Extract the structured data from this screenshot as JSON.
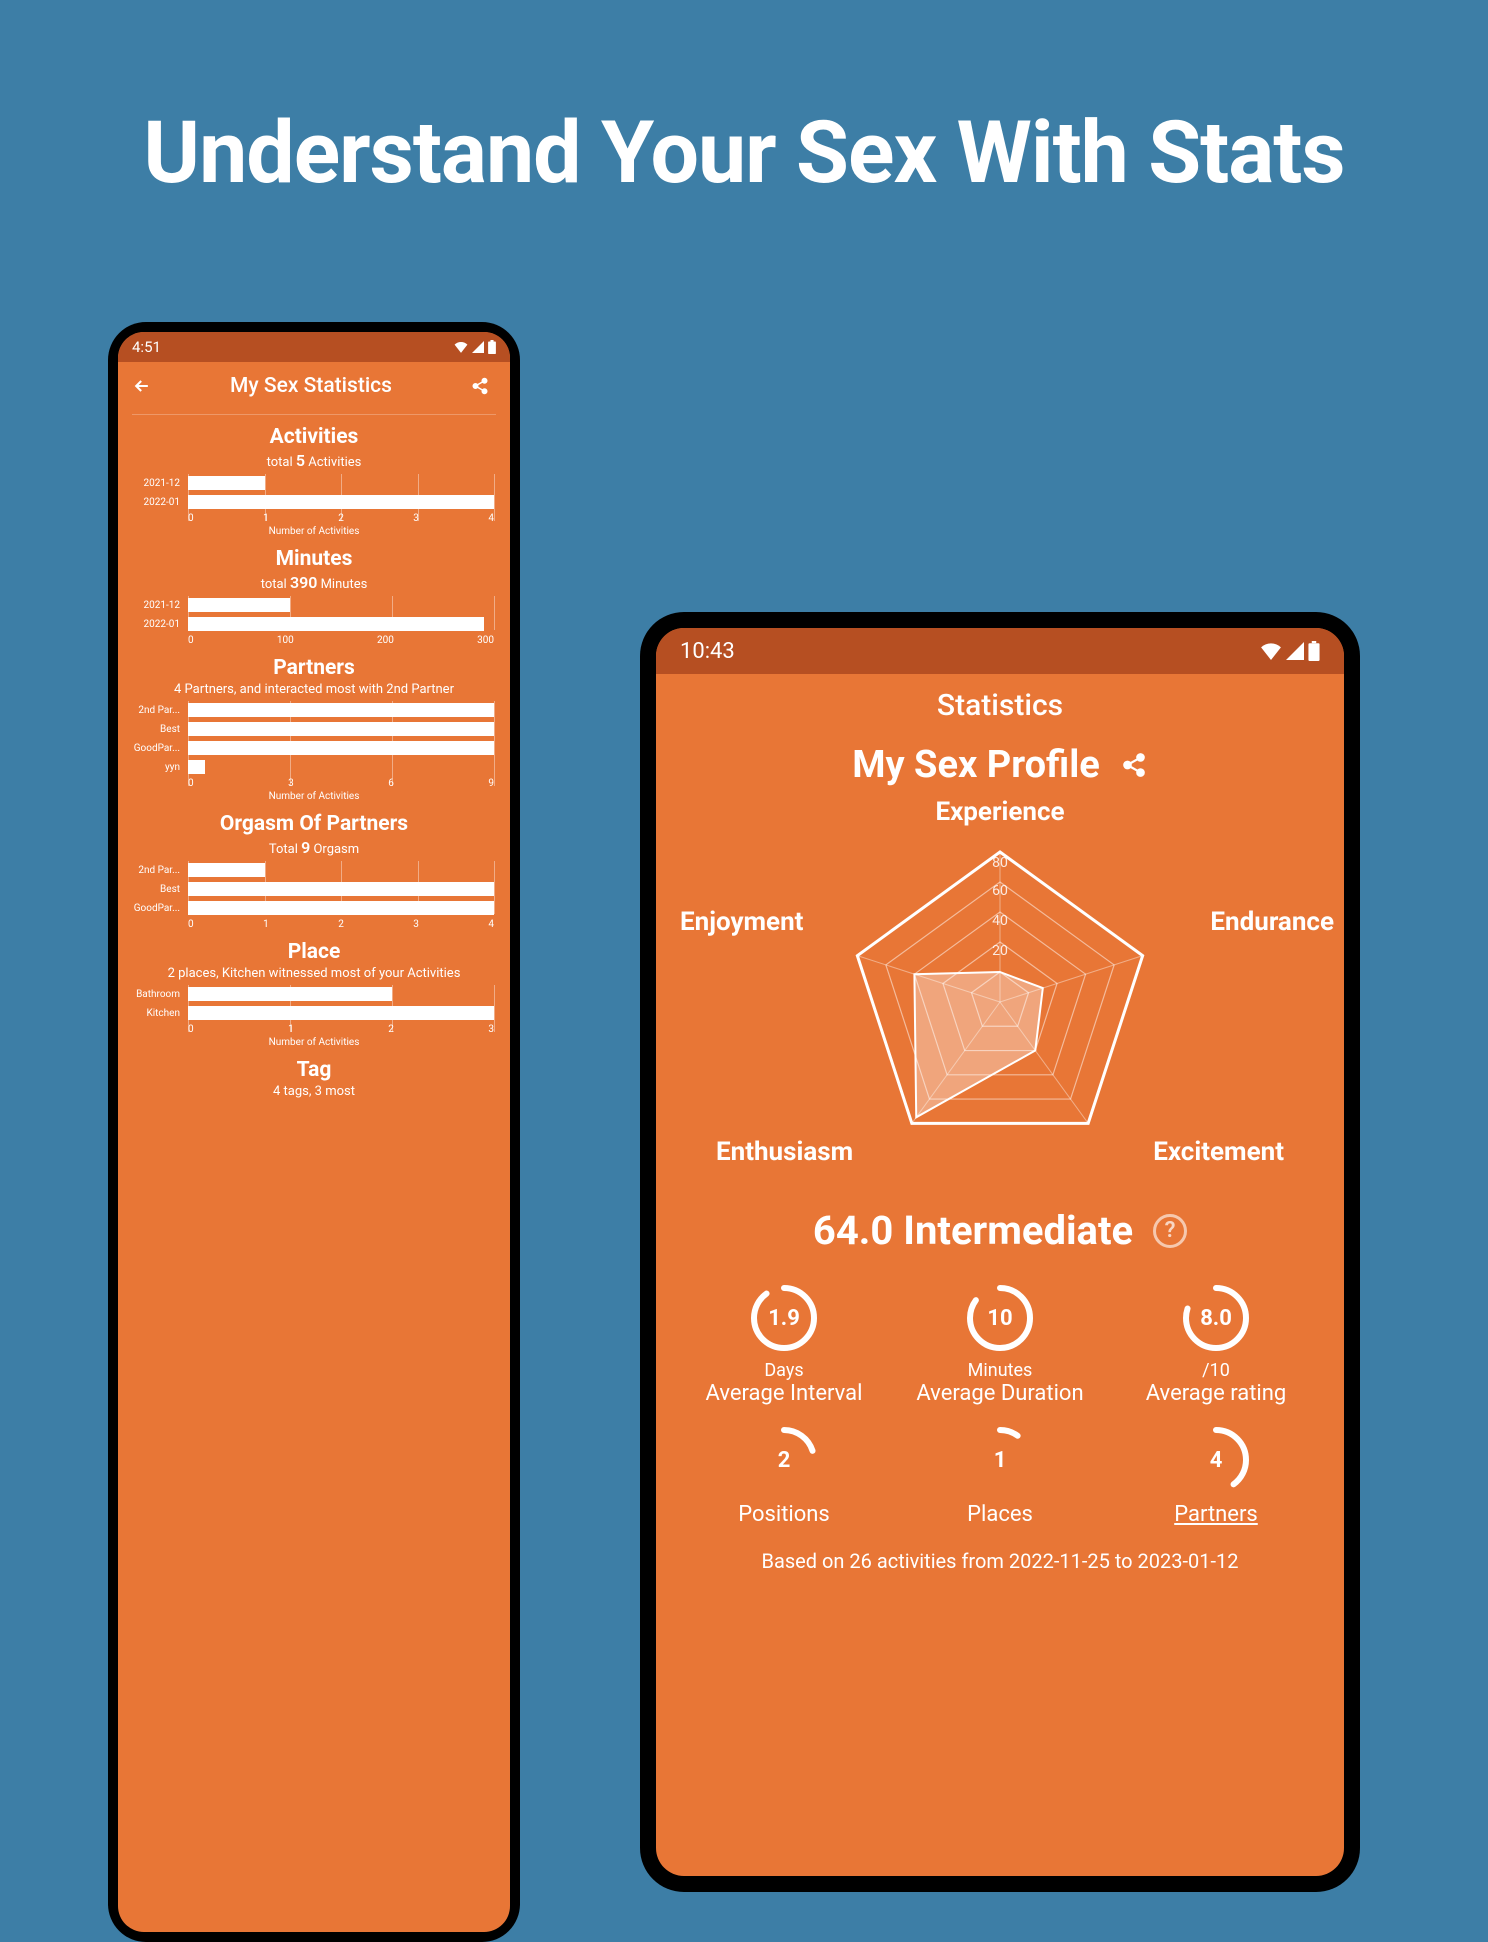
{
  "hero": {
    "title": "Understand Your Sex With Stats"
  },
  "left": {
    "status_time": "4:51",
    "appbar_title": "My Sex Statistics",
    "sections": {
      "activities": {
        "title": "Activities",
        "sub_prefix": "total",
        "sub_value": "5",
        "sub_suffix": "Activities",
        "axis_label": "Number of Activities"
      },
      "minutes": {
        "title": "Minutes",
        "sub_prefix": "total",
        "sub_value": "390",
        "sub_suffix": "Minutes"
      },
      "partners": {
        "title": "Partners",
        "sub_html": "4 Partners, and interacted most with 2nd Partner",
        "axis_label": "Number of Activities"
      },
      "orgasm": {
        "title": "Orgasm Of Partners",
        "sub_prefix": "Total",
        "sub_value": "9",
        "sub_suffix": "Orgasm"
      },
      "place": {
        "title": "Place",
        "sub_html": "2 places, Kitchen witnessed most of your Activities",
        "axis_label": "Number of Activities"
      },
      "tag": {
        "title": "Tag",
        "sub_html": "4 tags, 3 most"
      }
    }
  },
  "right": {
    "status_time": "10:43",
    "header": "Statistics",
    "profile_title": "My Sex Profile",
    "radar_labels": {
      "experience": "Experience",
      "endurance": "Endurance",
      "excitement": "Excitement",
      "enthusiasm": "Enthusiasm",
      "enjoyment": "Enjoyment"
    },
    "radar_ticks": {
      "t80": "80",
      "t60": "60",
      "t40": "40",
      "t20": "20"
    },
    "score": "64.0 Intermediate",
    "metrics": [
      {
        "value": "1.9",
        "unit": "Days",
        "label": "Average Interval",
        "pct": 90
      },
      {
        "value": "10",
        "unit": "Minutes",
        "label": "Average Duration",
        "pct": 85
      },
      {
        "value": "8.0",
        "unit": "/10",
        "label": "Average rating",
        "pct": 80
      },
      {
        "value": "2",
        "unit": "",
        "label": "Positions",
        "pct": 20
      },
      {
        "value": "1",
        "unit": "",
        "label": "Places",
        "pct": 10
      },
      {
        "value": "4",
        "unit": "",
        "label": "Partners",
        "pct": 40,
        "underline": true
      }
    ],
    "footer": "Based on 26 activities from 2022-11-25 to 2023-01-12"
  },
  "chart_data": [
    {
      "type": "bar",
      "orientation": "horizontal",
      "title": "Activities",
      "categories": [
        "2021-12",
        "2022-01"
      ],
      "values": [
        1,
        4
      ],
      "xlabel": "Number of Activities",
      "xlim": [
        0,
        4
      ],
      "ticks": [
        0,
        1,
        2,
        3,
        4
      ]
    },
    {
      "type": "bar",
      "orientation": "horizontal",
      "title": "Minutes",
      "categories": [
        "2021-12",
        "2022-01"
      ],
      "values": [
        100,
        290
      ],
      "xlim": [
        0,
        300
      ],
      "ticks": [
        0,
        100,
        200,
        300
      ]
    },
    {
      "type": "bar",
      "orientation": "horizontal",
      "title": "Partners",
      "categories": [
        "2nd Par...",
        "Best",
        "GoodPar...",
        "yyn"
      ],
      "values": [
        9,
        9,
        9,
        0.5
      ],
      "xlabel": "Number of Activities",
      "xlim": [
        0,
        9
      ],
      "ticks": [
        0,
        3,
        6,
        9
      ]
    },
    {
      "type": "bar",
      "orientation": "horizontal",
      "title": "Orgasm Of Partners",
      "categories": [
        "2nd Par...",
        "Best",
        "GoodPar..."
      ],
      "values": [
        1,
        4,
        4
      ],
      "xlim": [
        0,
        4
      ],
      "ticks": [
        0,
        1,
        2,
        3,
        4
      ]
    },
    {
      "type": "bar",
      "orientation": "horizontal",
      "title": "Place",
      "categories": [
        "Bathroom",
        "Kitchen"
      ],
      "values": [
        2,
        3
      ],
      "xlabel": "Number of Activities",
      "xlim": [
        0,
        3
      ],
      "ticks": [
        0,
        1,
        2,
        3
      ]
    },
    {
      "type": "radar",
      "title": "My Sex Profile",
      "categories": [
        "Experience",
        "Endurance",
        "Excitement",
        "Enthusiasm",
        "Enjoyment"
      ],
      "values": [
        20,
        30,
        40,
        95,
        60
      ],
      "max": 100,
      "ticks": [
        20,
        40,
        60,
        80
      ]
    }
  ]
}
